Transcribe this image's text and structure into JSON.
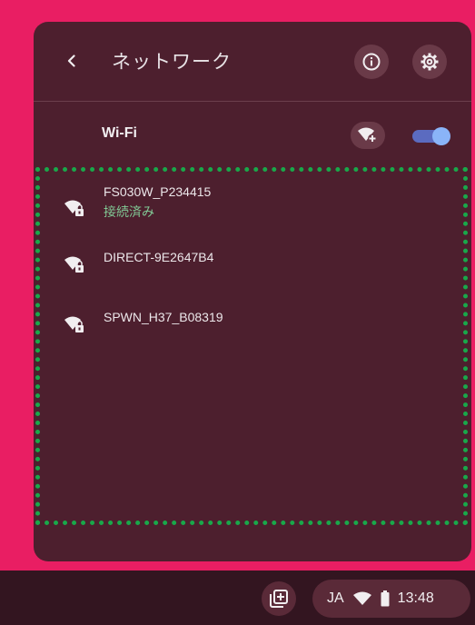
{
  "header": {
    "title": "ネットワーク",
    "back_icon": "chevron-left-icon",
    "info_icon": "info-icon",
    "settings_icon": "gear-icon"
  },
  "wifi": {
    "label": "Wi-Fi",
    "add_network_icon": "wifi-add-icon",
    "enabled": true
  },
  "networks": [
    {
      "ssid": "FS030W_P234415",
      "status": "接続済み",
      "icon": "wifi-lock-icon"
    },
    {
      "ssid": "DIRECT-9E2647B4",
      "status": "",
      "icon": "wifi-lock-icon"
    },
    {
      "ssid": "SPWN_H37_B08319",
      "status": "",
      "icon": "wifi-lock-icon"
    }
  ],
  "shelf": {
    "holding_space_icon": "holding-space-icon",
    "ime": "JA",
    "wifi_icon": "wifi-icon",
    "battery_icon": "battery-icon",
    "time": "13:48"
  },
  "colors": {
    "wallpaper": "#e91e63",
    "panel": "#4d1f2e",
    "status_connected": "#81c995",
    "highlight_border": "#19a84a",
    "toggle_on": "#8ab4f8"
  }
}
